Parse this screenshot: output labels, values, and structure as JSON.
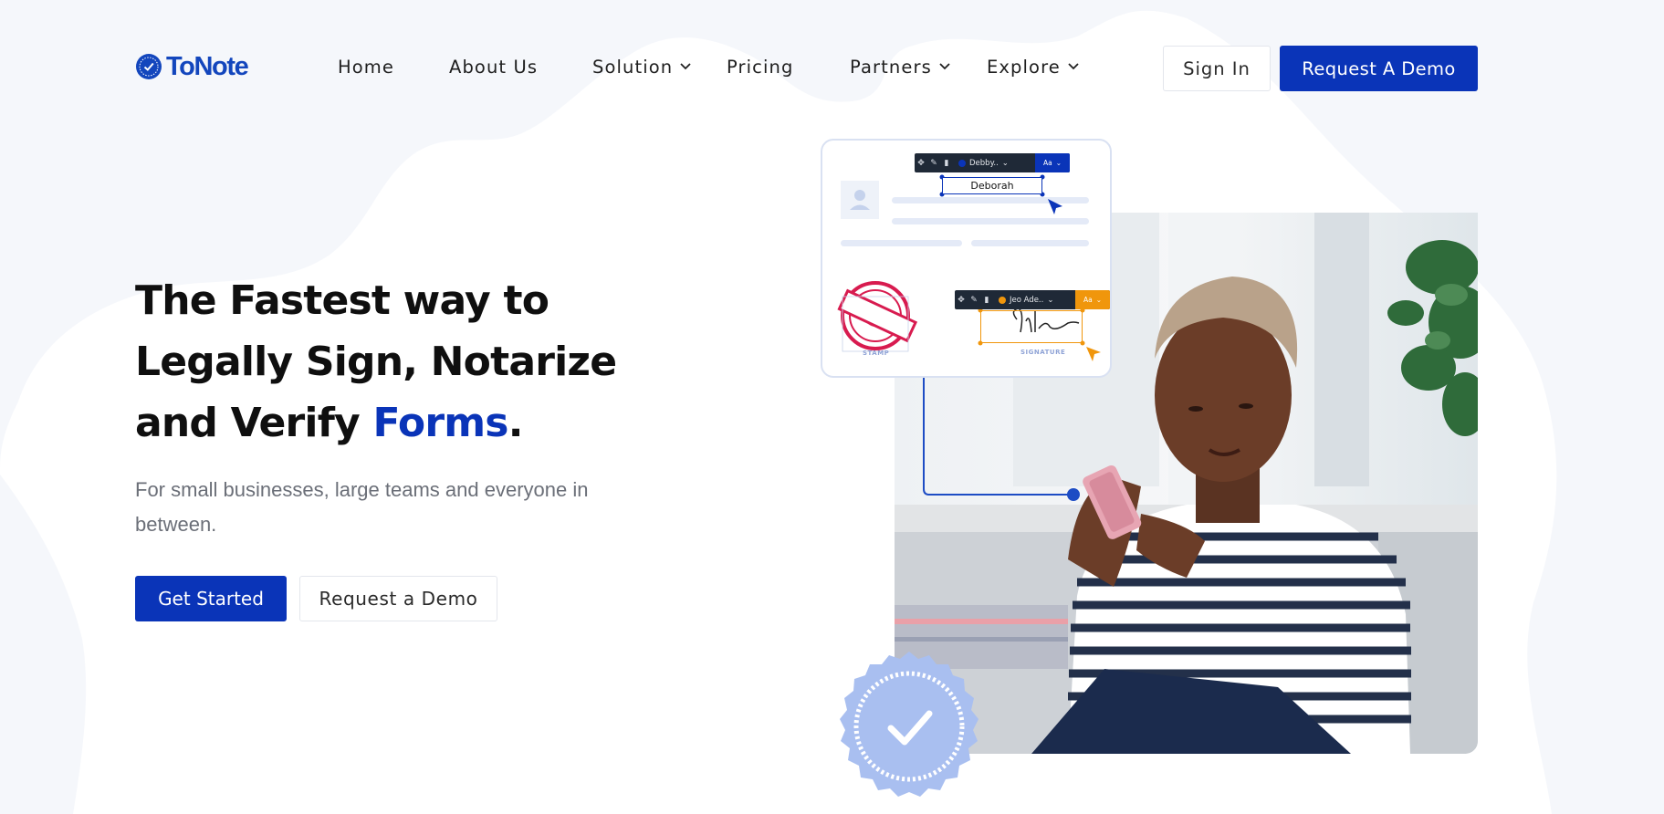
{
  "brand": {
    "name": "ToNote",
    "color": "#1346bd",
    "logo_icon": "check-circle-icon"
  },
  "nav": {
    "items": [
      {
        "label": "Home"
      },
      {
        "label": "About Us"
      },
      {
        "label": "Solution",
        "icon": "chevron-down-icon"
      },
      {
        "label": "Pricing"
      },
      {
        "label": "Partners",
        "icon": "chevron-down-icon"
      },
      {
        "label": "Explore",
        "icon": "chevron-down-icon"
      }
    ],
    "sign_in": "Sign In",
    "request_demo": "Request A Demo"
  },
  "hero": {
    "line1": "The Fastest way to",
    "line2": "Legally Sign, Notarize",
    "line3_prefix": "and Verify ",
    "line3_accent": "Forms",
    "line3_suffix": ".",
    "subtitle": "For small businesses, large teams and everyone in between.",
    "primary_cta": "Get Started",
    "secondary_cta": "Request a Demo"
  },
  "illustration": {
    "name_toolbar": {
      "user": "Debby..",
      "font_button": "Aa"
    },
    "name_field": "Deborah",
    "signature_toolbar": {
      "user": "Jeo Ade..",
      "font_button": "Aa"
    },
    "stamp_label": "STAMP",
    "signature_label": "SIGNATURE"
  },
  "colors": {
    "primary": "#0a34b8",
    "accent_orange": "#f0960c",
    "stamp_red": "#d81b4f",
    "background_blob": "#f4f6fb",
    "badge": "#a9bff0"
  }
}
